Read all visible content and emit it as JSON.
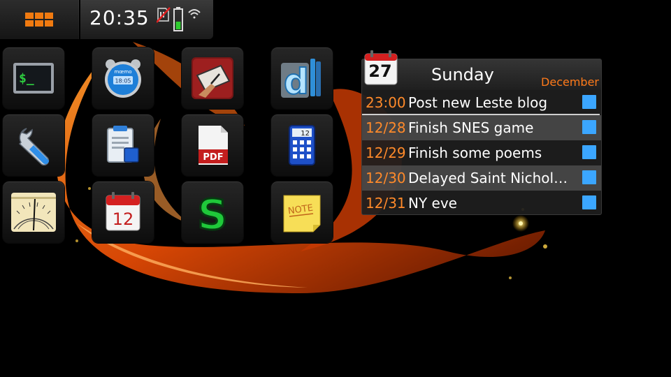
{
  "status_bar": {
    "menu_icon": "app-grid-icon",
    "time": "20:35",
    "icons": [
      "sim-off-icon",
      "battery-icon",
      "wifi-icon"
    ],
    "accent": "#f07a10"
  },
  "apps": [
    {
      "icon": "terminal-icon"
    },
    {
      "icon": "alarm-clock-icon",
      "label": "mœmo",
      "time": "18:05"
    },
    {
      "icon": "drawing-tablet-icon"
    },
    {
      "icon": "document-library-icon"
    },
    {
      "icon": "wrench-icon"
    },
    {
      "icon": "clipboard-icon"
    },
    {
      "icon": "pdf-icon",
      "label": "PDF"
    },
    {
      "icon": "calculator-icon",
      "label": "12"
    },
    {
      "icon": "slide-rule-icon"
    },
    {
      "icon": "calendar-icon",
      "label": "12"
    },
    {
      "icon": "money-s-icon",
      "label": "S"
    },
    {
      "icon": "note-icon",
      "label": "NOTE"
    }
  ],
  "calendar": {
    "day_number": "27",
    "weekday": "Sunday",
    "month": "December",
    "accent": "#ff7a1a",
    "events": [
      {
        "time": "23:00",
        "title": "Post new Leste blog",
        "color": "#3ba6ff"
      },
      {
        "time": "12/28",
        "title": "Finish SNES game",
        "color": "#3ba6ff"
      },
      {
        "time": "12/29",
        "title": "Finish some poems",
        "color": "#3ba6ff"
      },
      {
        "time": "12/30",
        "title": "Delayed Saint Nichol…",
        "color": "#3ba6ff"
      },
      {
        "time": "12/31",
        "title": "NY eve",
        "color": "#3ba6ff"
      }
    ]
  }
}
